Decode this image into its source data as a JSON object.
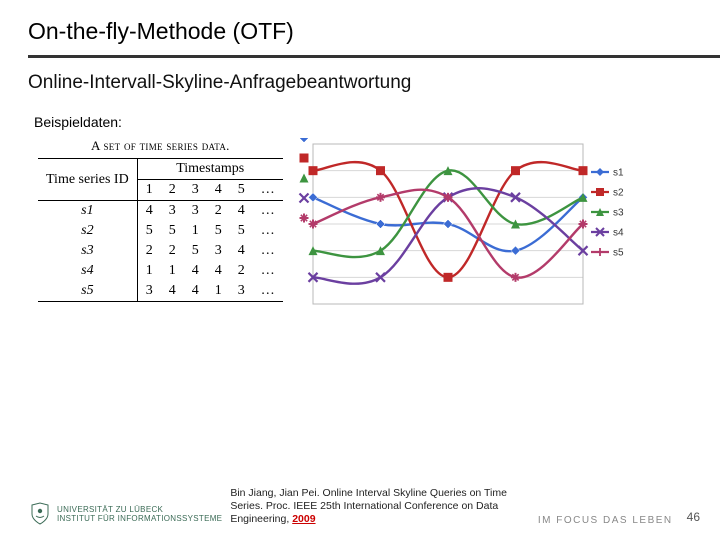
{
  "title": "On-the-fly-Methode (OTF)",
  "subtitle": "Online-Intervall-Skyline-Anfragebeantwortung",
  "example_label": "Beispieldaten:",
  "table": {
    "caption": "A set of time series data.",
    "head_left": "Time series ID",
    "head_right": "Timestamps",
    "timestamps": [
      "1",
      "2",
      "3",
      "4",
      "5",
      "…"
    ],
    "rows": [
      {
        "id": "s1",
        "vals": [
          "4",
          "3",
          "3",
          "2",
          "4",
          "…"
        ]
      },
      {
        "id": "s2",
        "vals": [
          "5",
          "5",
          "1",
          "5",
          "5",
          "…"
        ]
      },
      {
        "id": "s3",
        "vals": [
          "2",
          "2",
          "5",
          "3",
          "4",
          "…"
        ]
      },
      {
        "id": "s4",
        "vals": [
          "1",
          "1",
          "4",
          "4",
          "2",
          "…"
        ]
      },
      {
        "id": "s5",
        "vals": [
          "3",
          "4",
          "4",
          "1",
          "3",
          "…"
        ]
      }
    ]
  },
  "chart_data": {
    "type": "line",
    "x": [
      1,
      2,
      3,
      4,
      5
    ],
    "xlim": [
      1,
      5
    ],
    "ylim": [
      0,
      6
    ],
    "ygrid": [
      0,
      1,
      2,
      3,
      4,
      5,
      6
    ],
    "series": [
      {
        "name": "s1",
        "values": [
          4,
          3,
          3,
          2,
          4
        ],
        "color": "#3b6cd4",
        "marker": "diamond"
      },
      {
        "name": "s2",
        "values": [
          5,
          5,
          1,
          5,
          5
        ],
        "color": "#c02828",
        "marker": "square"
      },
      {
        "name": "s3",
        "values": [
          2,
          2,
          5,
          3,
          4
        ],
        "color": "#3d9440",
        "marker": "triangle"
      },
      {
        "name": "s4",
        "values": [
          1,
          1,
          4,
          4,
          2
        ],
        "color": "#6b3fa0",
        "marker": "cross"
      },
      {
        "name": "s5",
        "values": [
          3,
          4,
          4,
          1,
          3
        ],
        "color": "#b33b6a",
        "marker": "star"
      }
    ]
  },
  "footer": {
    "uni": "UNIVERSITÄT ZU LÜBECK",
    "institute": "INSTITUT FÜR INFORMATIONSSYSTEME",
    "citation_pre": "Bin Jiang, Jian Pei. Online Interval Skyline Queries on Time Series. Proc. IEEE 25th International Conference on Data Engineering, ",
    "citation_year": "2009",
    "focus": "IM FOCUS DAS LEBEN",
    "slide_number": "46"
  }
}
